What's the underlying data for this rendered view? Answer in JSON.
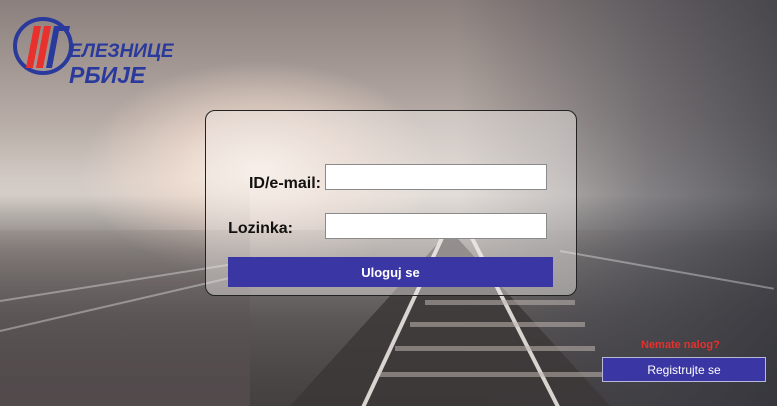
{
  "brand": {
    "line1": "ЕЛЕЗНИЦЕ",
    "line2": "РБИЈЕ",
    "accent_color": "#e8302d",
    "primary_color": "#2a3a9c"
  },
  "login": {
    "id_label": "ID/e-mail:",
    "id_value": "",
    "password_label": "Lozinka:",
    "password_value": "",
    "submit_label": "Uloguj se"
  },
  "register": {
    "prompt": "Nemate nalog?",
    "button_label": "Registrujte se"
  },
  "colors": {
    "button_bg": "#3a36a4",
    "prompt_text": "#e8302d"
  }
}
